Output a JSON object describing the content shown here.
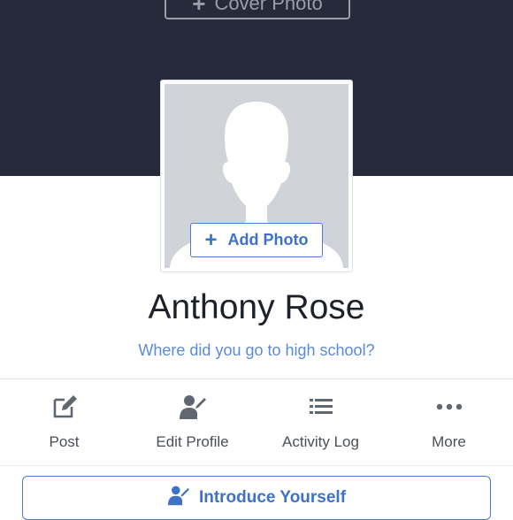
{
  "cover": {
    "button_label": "Cover Photo"
  },
  "profile": {
    "add_photo_label": "Add Photo",
    "name": "Anthony Rose",
    "prompt": "Where did you go to high school?"
  },
  "actions": [
    {
      "label": "Post",
      "icon": "compose-icon"
    },
    {
      "label": "Edit Profile",
      "icon": "edit-profile-icon"
    },
    {
      "label": "Activity Log",
      "icon": "list-icon"
    },
    {
      "label": "More",
      "icon": "more-dots-icon"
    }
  ],
  "intro": {
    "label": "Introduce Yourself",
    "icon": "edit-profile-icon"
  },
  "colors": {
    "cover_bg": "#262b3b",
    "accent_blue": "#3e72c9",
    "icon_gray": "#606770",
    "avatar_bg": "#d0d3d8"
  }
}
